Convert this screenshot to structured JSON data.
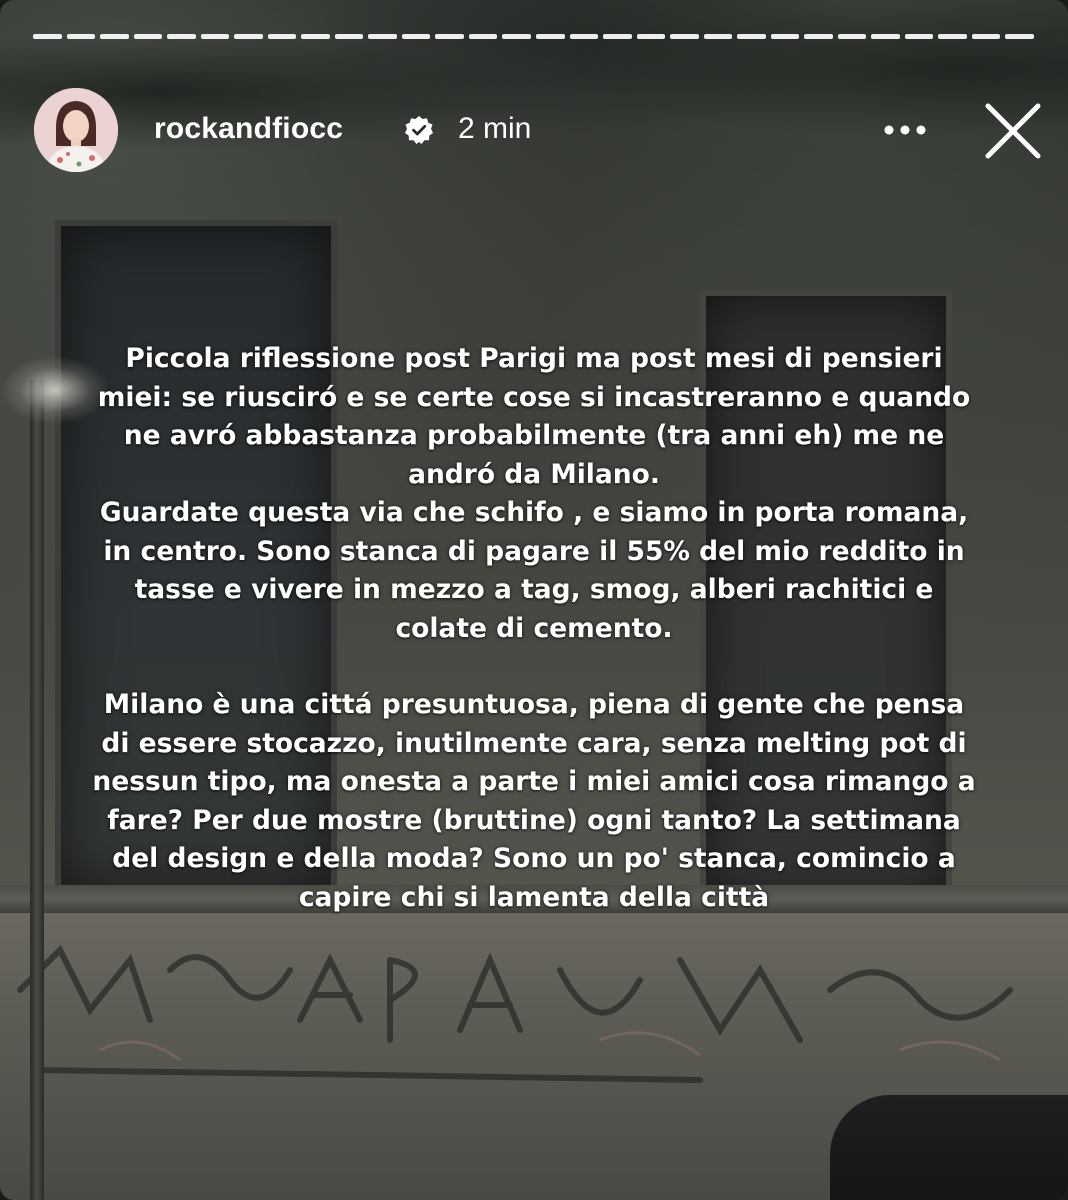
{
  "story": {
    "progress": {
      "segments_total": 30,
      "segments_viewed": 30
    },
    "header": {
      "username": "rockandfiocc",
      "verified": true,
      "time": "2 min",
      "more_icon": "more-horizontal-icon",
      "close_icon": "close-icon"
    },
    "caption": {
      "paragraph_1": [
        "Piccola riflessione post Parigi ma post mesi di pensieri",
        "miei: se riusciró e se certe cose si incastreranno e quando",
        "ne avró abbastanza probabilmente (tra anni eh) me ne",
        "andró da Milano.",
        "Guardate questa via che schifo , e siamo in porta romana,",
        "in centro. Sono stanca di pagare il 55% del mio reddito in",
        "tasse e vivere in mezzo a tag, smog, alberi rachitici e",
        "colate di cemento."
      ],
      "paragraph_2": [
        "Milano è una cittá presuntuosa, piena di gente che pensa",
        "di essere stocazzo, inutilmente cara, senza melting pot di",
        "nessun tipo, ma onesta a parte i miei amici cosa rimango a",
        "fare? Per due mostre (bruttine) ogni tanto? La settimana",
        "del design e della moda? Sono un po' stanca, comincio a",
        "capire chi si lamenta della città"
      ]
    },
    "colors": {
      "text": "#ffffff",
      "verified_badge": "#ffffff",
      "avatar_bg": "#e9c9c9"
    }
  }
}
